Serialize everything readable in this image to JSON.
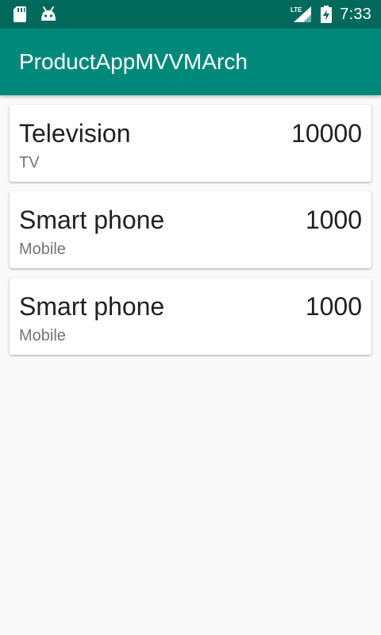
{
  "status_bar": {
    "time": "7:33",
    "network_label": "LTE",
    "icons": [
      "sd-card-icon",
      "android-debug-icon",
      "signal-icon",
      "battery-charging-icon"
    ],
    "background": "#00695c"
  },
  "app_bar": {
    "title": "ProductAppMVVMArch",
    "background": "#00897b"
  },
  "products": [
    {
      "name": "Television",
      "price": "10000",
      "category": "TV"
    },
    {
      "name": "Smart phone",
      "price": "1000",
      "category": "Mobile"
    },
    {
      "name": "Smart phone",
      "price": "1000",
      "category": "Mobile"
    }
  ]
}
